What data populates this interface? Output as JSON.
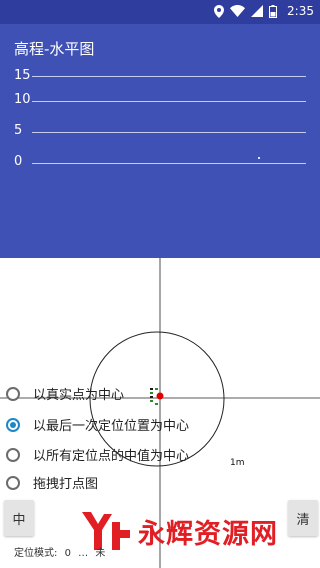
{
  "status_bar": {
    "time": "2:35"
  },
  "header": {
    "title": "高程-水平图",
    "ticks": [
      "15",
      "10",
      "5",
      "0"
    ]
  },
  "plot": {
    "scale_label": "1m"
  },
  "options": [
    {
      "label": "以真实点为中心",
      "checked": false
    },
    {
      "label": "以最后一次定位位置为中心",
      "checked": true
    },
    {
      "label": "以所有定位点的中值为中心",
      "checked": false
    },
    {
      "label": "拖拽打点图",
      "checked": false
    }
  ],
  "buttons": {
    "left": "中",
    "right": "清"
  },
  "footer": {
    "mode_label": "定位模式:",
    "mode_value": "0",
    "extra": "…",
    "status": "未"
  },
  "watermark": {
    "text": "永辉资源网"
  },
  "colors": {
    "status_bar": "#2f3e9e",
    "header": "#3f51b5",
    "selected": "#1e88c7",
    "marker": "#e00000",
    "watermark": "#e01e23"
  }
}
